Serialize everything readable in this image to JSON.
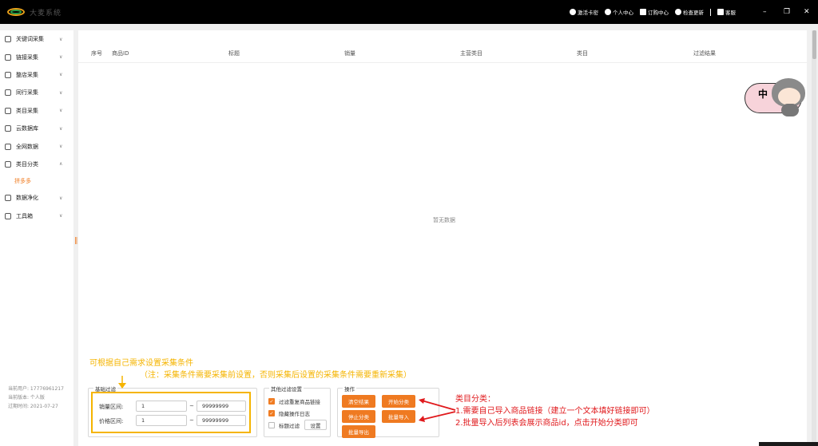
{
  "titlebar": {
    "logo_text": "大麦系统",
    "links": [
      "激活卡密",
      "个人中心",
      "订购中心",
      "检查更新",
      "客服"
    ],
    "win_controls": [
      "–",
      "❐",
      "✕"
    ]
  },
  "sidebar": {
    "items": [
      {
        "label": "关键词采集",
        "icon": "text-icon"
      },
      {
        "label": "链接采集",
        "icon": "link-icon"
      },
      {
        "label": "整店采集",
        "icon": "store-icon"
      },
      {
        "label": "同行采集",
        "icon": "users-icon"
      },
      {
        "label": "类目采集",
        "icon": "folder-icon"
      },
      {
        "label": "云数据库",
        "icon": "cloud-icon"
      },
      {
        "label": "全网数据",
        "icon": "globe-icon"
      },
      {
        "label": "类目分类",
        "icon": "grid-icon"
      }
    ],
    "sub_item": "拼多多",
    "items_after": [
      {
        "label": "数据净化",
        "icon": "filter-icon"
      },
      {
        "label": "工具箱",
        "icon": "toolbox-icon"
      }
    ],
    "info": {
      "user": "当前用户: 17776961217",
      "version": "当前版本: 个人版",
      "expire": "过期时间: 2021-07-27"
    }
  },
  "table": {
    "columns": [
      "序号",
      "商品ID",
      "标题",
      "销量",
      "主营类目",
      "类目",
      "过滤结果"
    ],
    "empty_text": "暂无数据"
  },
  "mascot": {
    "bubble_char": "中"
  },
  "filters": {
    "basic": {
      "legend": "基础过滤",
      "sales_label": "销量区间:",
      "sales_min": "1",
      "sales_max": "99999999",
      "price_label": "价格区间:",
      "price_min": "1",
      "price_max": "99999999",
      "tilde": "~"
    },
    "other": {
      "legend": "其他过滤设置",
      "options": [
        {
          "label": "过滤重复商品链接",
          "checked": true
        },
        {
          "label": "隐藏操作日志",
          "checked": true
        },
        {
          "label": "标题过滤",
          "checked": false
        }
      ],
      "settings_button": "设置"
    },
    "ops": {
      "legend": "操作",
      "buttons": [
        "清空结果",
        "开始分类",
        "停止分类",
        "批量导入",
        "批量导出"
      ]
    }
  },
  "annotations": {
    "yellow_line1": "可根据自己需求设置采集条件",
    "yellow_line2": "（注：采集条件需要采集前设置，否则采集后设置的采集条件需要重新采集）",
    "red_title": "类目分类：",
    "red_line1": "1.需要自己导入商品链接（建立一个文本填好链接即可）",
    "red_line2": "2.批量导入后列表会展示商品id，点击开始分类即可"
  },
  "colors": {
    "accent": "#ef7a21",
    "annotation_yellow": "#f5b400",
    "annotation_red": "#e0191c"
  }
}
